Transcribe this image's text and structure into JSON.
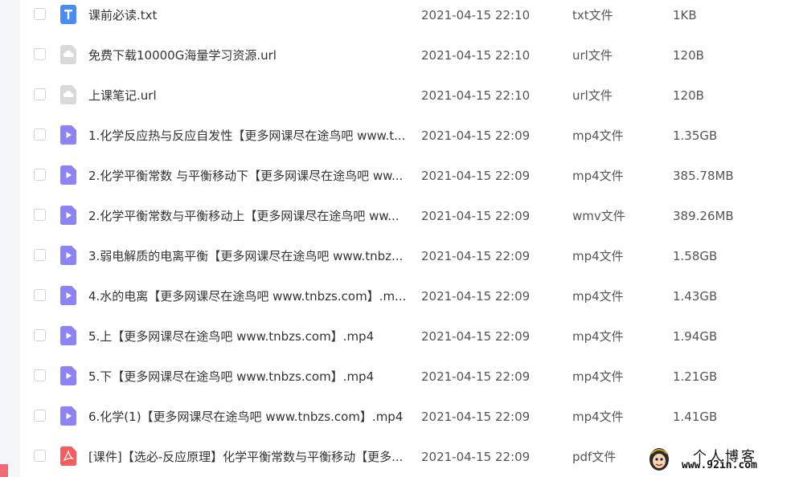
{
  "colors": {
    "text_primary": "#333333",
    "text_secondary": "#555555",
    "txt_icon": "#4a8cf7",
    "url_icon": "#d9d9d9",
    "video_icon": "#8c83f4",
    "pdf_icon": "#f25d5d"
  },
  "files": [
    {
      "icon": "txt-file-icon",
      "name": "课前必读.txt",
      "date": "2021-04-15 22:10",
      "type": "txt文件",
      "size": "1KB"
    },
    {
      "icon": "url-file-icon",
      "name": "免费下载10000G海量学习资源.url",
      "date": "2021-04-15 22:10",
      "type": "url文件",
      "size": "120B"
    },
    {
      "icon": "url-file-icon",
      "name": "上课笔记.url",
      "date": "2021-04-15 22:10",
      "type": "url文件",
      "size": "120B"
    },
    {
      "icon": "video-file-icon",
      "name": "1.化学反应热与反应自发性【更多网课尽在途鸟吧 www.t...",
      "date": "2021-04-15 22:09",
      "type": "mp4文件",
      "size": "1.35GB"
    },
    {
      "icon": "video-file-icon",
      "name": "2.化学平衡常数 与平衡移动下【更多网课尽在途鸟吧 ww...",
      "date": "2021-04-15 22:09",
      "type": "mp4文件",
      "size": "385.78MB"
    },
    {
      "icon": "video-file-icon",
      "name": "2.化学平衡常数与平衡移动上【更多网课尽在途鸟吧 ww...",
      "date": "2021-04-15 22:09",
      "type": "wmv文件",
      "size": "389.26MB"
    },
    {
      "icon": "video-file-icon",
      "name": "3.弱电解质的电离平衡【更多网课尽在途鸟吧 www.tnbz...",
      "date": "2021-04-15 22:09",
      "type": "mp4文件",
      "size": "1.58GB"
    },
    {
      "icon": "video-file-icon",
      "name": "4.水的电离【更多网课尽在途鸟吧 www.tnbzs.com】.m...",
      "date": "2021-04-15 22:09",
      "type": "mp4文件",
      "size": "1.43GB"
    },
    {
      "icon": "video-file-icon",
      "name": "5.上【更多网课尽在途鸟吧 www.tnbzs.com】.mp4",
      "date": "2021-04-15 22:09",
      "type": "mp4文件",
      "size": "1.94GB"
    },
    {
      "icon": "video-file-icon",
      "name": "5.下【更多网课尽在途鸟吧 www.tnbzs.com】.mp4",
      "date": "2021-04-15 22:09",
      "type": "mp4文件",
      "size": "1.21GB"
    },
    {
      "icon": "video-file-icon",
      "name": "6.化学(1)【更多网课尽在途鸟吧 www.tnbzs.com】.mp4",
      "date": "2021-04-15 22:09",
      "type": "mp4文件",
      "size": "1.41GB"
    },
    {
      "icon": "pdf-file-icon",
      "name": "[课件]【选必-反应原理】化学平衡常数与平衡移动【更多...",
      "date": "2021-04-15 22:09",
      "type": "pdf文件",
      "size": ""
    }
  ],
  "watermark": {
    "title": "个人博客",
    "url": "www.92in.com",
    "icon": "mascot-icon"
  }
}
